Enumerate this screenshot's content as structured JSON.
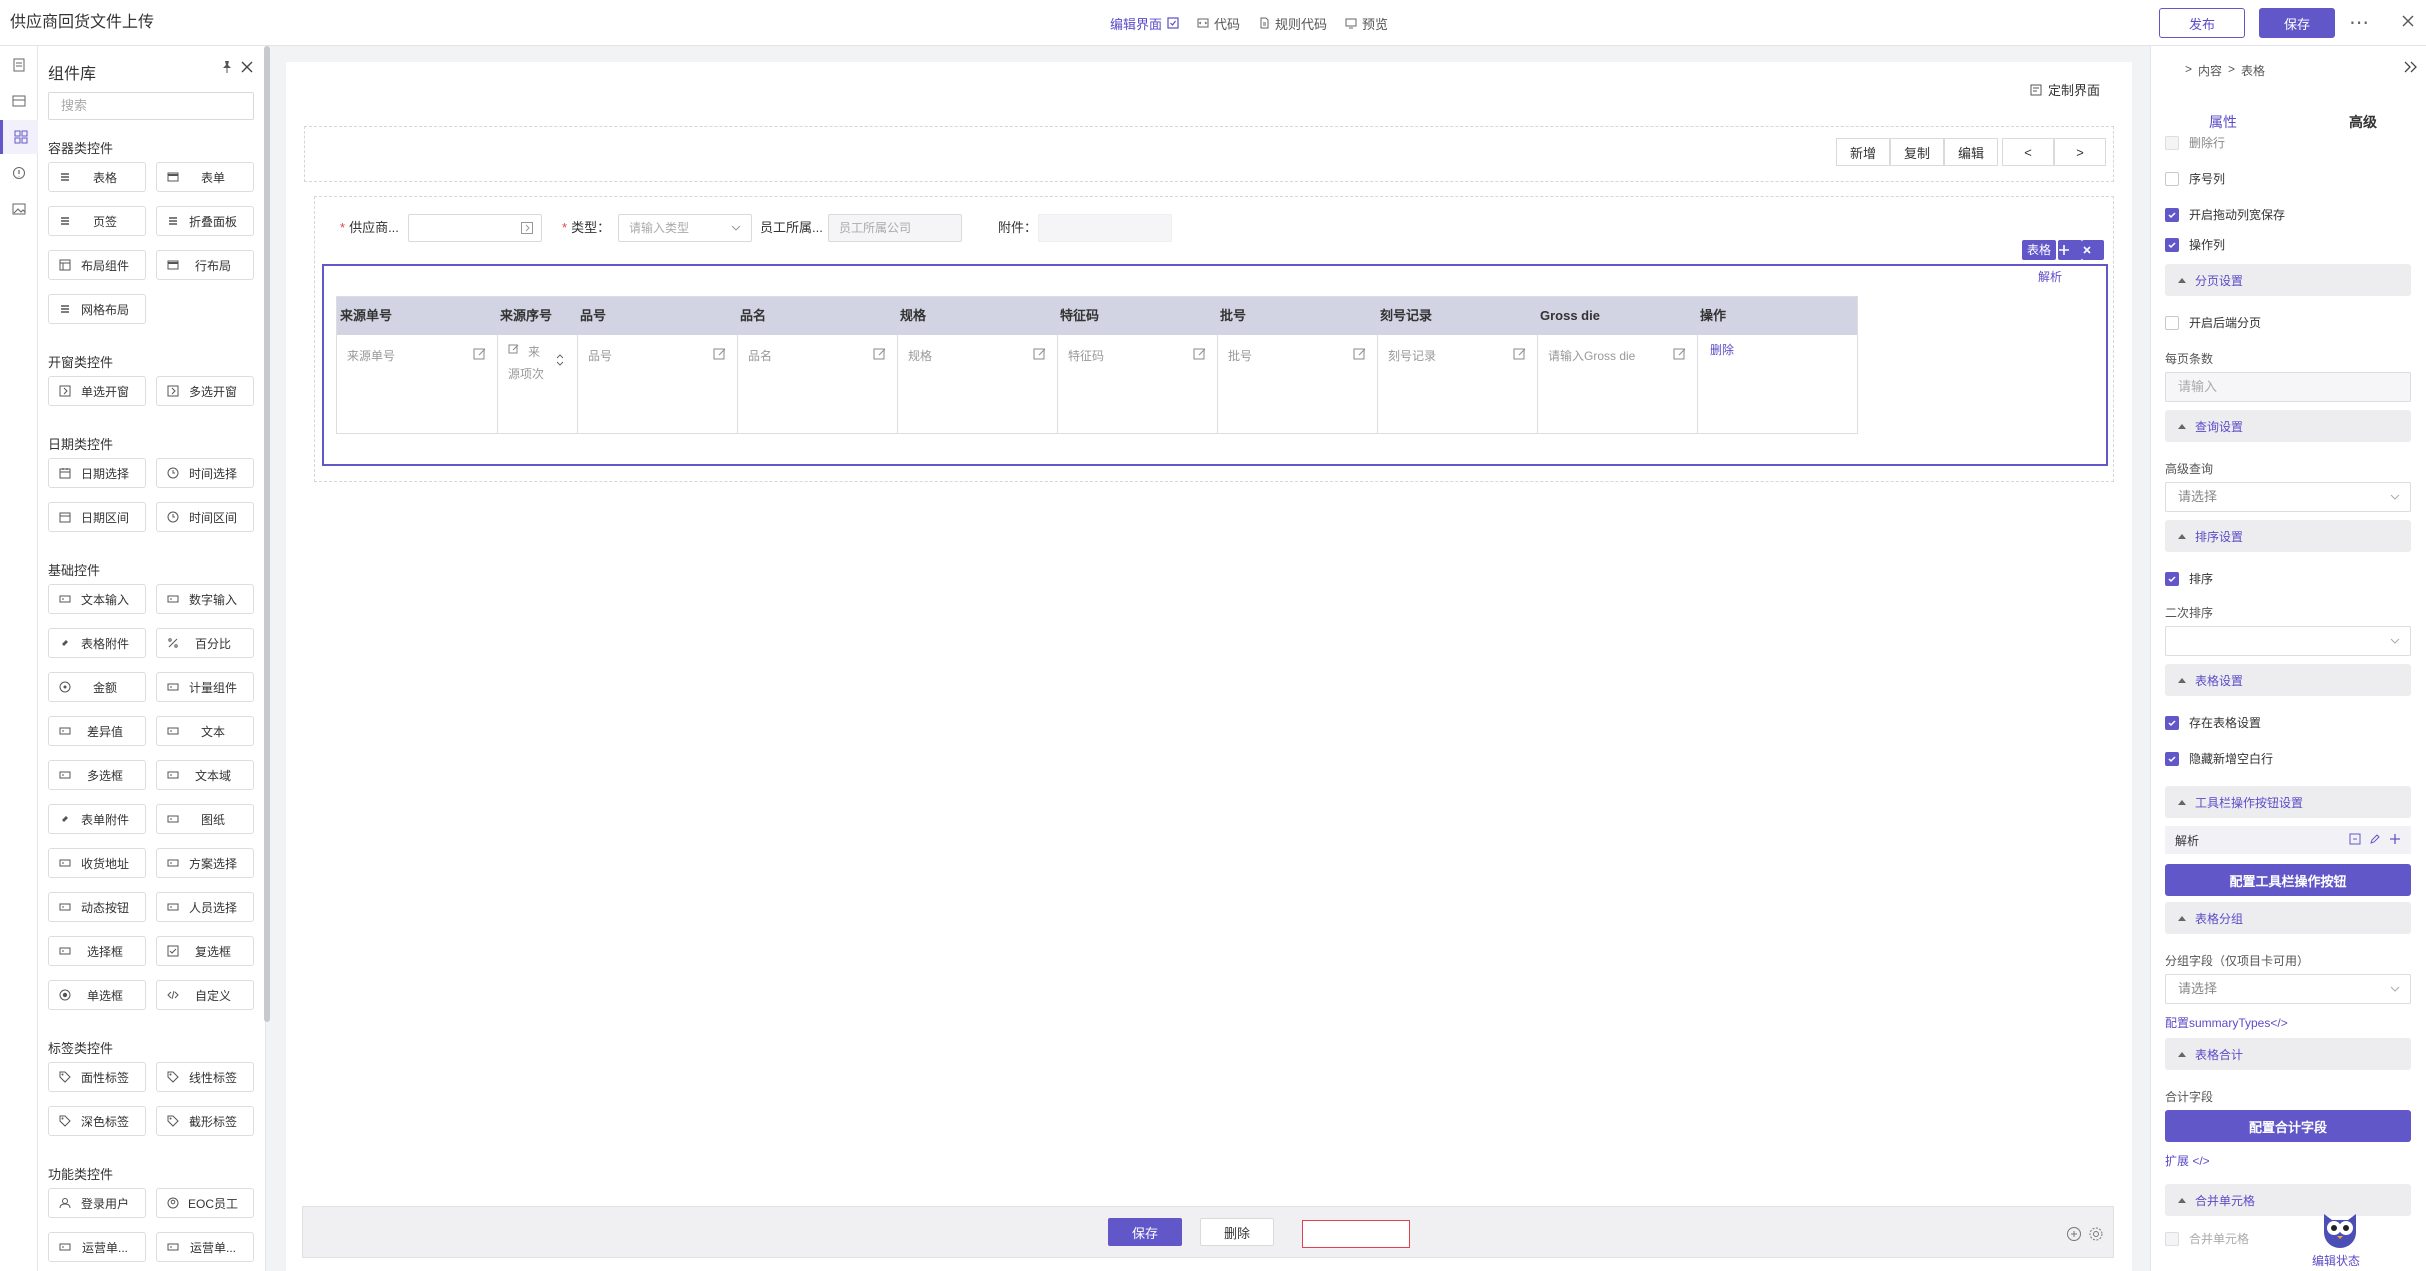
{
  "app": {
    "title": "供应商回货文件上传",
    "center_tabs": [
      {
        "label": "编辑界面",
        "icon": "edit-box-icon",
        "active": true
      },
      {
        "label": "代码",
        "icon": "code-icon",
        "active": false
      },
      {
        "label": "规则代码",
        "icon": "rule-code-icon",
        "active": false
      },
      {
        "label": "预览",
        "icon": "preview-icon",
        "active": false
      }
    ],
    "publish_label": "发布",
    "save_label": "保存",
    "more_label": "⋯"
  },
  "colors": {
    "accent": "#6257c9",
    "header_row": "#d3d4e3",
    "required": "#e0434f"
  },
  "library": {
    "title": "组件库",
    "search_placeholder": "搜索",
    "sections": [
      {
        "title": "容器类控件",
        "items": [
          {
            "label": "表格",
            "icon": "table-stack-icon"
          },
          {
            "label": "表单",
            "icon": "form-icon"
          },
          {
            "label": "页签",
            "icon": "tabs-icon"
          },
          {
            "label": "折叠面板",
            "icon": "collapse-icon"
          },
          {
            "label": "布局组件",
            "icon": "layout-icon"
          },
          {
            "label": "行布局",
            "icon": "row-layout-icon"
          },
          {
            "label": "网格布局",
            "icon": "grid-layout-icon"
          }
        ]
      },
      {
        "title": "开窗类控件",
        "items": [
          {
            "label": "单选开窗",
            "icon": "single-window-icon"
          },
          {
            "label": "多选开窗",
            "icon": "multi-window-icon"
          }
        ]
      },
      {
        "title": "日期类控件",
        "items": [
          {
            "label": "日期选择",
            "icon": "calendar-icon"
          },
          {
            "label": "时间选择",
            "icon": "clock-icon"
          },
          {
            "label": "日期区间",
            "icon": "calendar-range-icon"
          },
          {
            "label": "时间区间",
            "icon": "clock-range-icon"
          }
        ]
      },
      {
        "title": "基础控件",
        "items": [
          {
            "label": "文本输入",
            "icon": "text-input-icon"
          },
          {
            "label": "数字输入",
            "icon": "number-input-icon"
          },
          {
            "label": "表格附件",
            "icon": "attachment-icon"
          },
          {
            "label": "百分比",
            "icon": "percent-icon"
          },
          {
            "label": "金额",
            "icon": "amount-icon"
          },
          {
            "label": "计量组件",
            "icon": "measure-icon"
          },
          {
            "label": "差异值",
            "icon": "diff-icon"
          },
          {
            "label": "文本",
            "icon": "text-icon"
          },
          {
            "label": "多选框",
            "icon": "multi-select-icon"
          },
          {
            "label": "文本域",
            "icon": "textarea-icon"
          },
          {
            "label": "表单附件",
            "icon": "form-attachment-icon"
          },
          {
            "label": "图纸",
            "icon": "drawing-icon"
          },
          {
            "label": "收货地址",
            "icon": "address-icon"
          },
          {
            "label": "方案选择",
            "icon": "scheme-icon"
          },
          {
            "label": "动态按钮",
            "icon": "dynamic-button-icon"
          },
          {
            "label": "人员选择",
            "icon": "person-select-icon"
          },
          {
            "label": "选择框",
            "icon": "select-box-icon"
          },
          {
            "label": "复选框",
            "icon": "checkbox-icon"
          },
          {
            "label": "单选框",
            "icon": "radio-icon"
          },
          {
            "label": "自定义",
            "icon": "custom-code-icon"
          }
        ]
      },
      {
        "title": "标签类控件",
        "items": [
          {
            "label": "面性标签",
            "icon": "tag-icon"
          },
          {
            "label": "线性标签",
            "icon": "tag-icon"
          },
          {
            "label": "深色标签",
            "icon": "tag-icon"
          },
          {
            "label": "截形标签",
            "icon": "tag-icon"
          }
        ]
      },
      {
        "title": "功能类控件",
        "items": [
          {
            "label": "登录用户",
            "icon": "user-icon"
          },
          {
            "label": "EOC员工",
            "icon": "employee-icon"
          },
          {
            "label": "运营单...",
            "icon": "ops-unit-icon"
          },
          {
            "label": "运营单...",
            "icon": "ops-unit-icon"
          }
        ]
      }
    ]
  },
  "canvas": {
    "custom_ui_label": "定制界面",
    "toolbar": [
      "新增",
      "复制",
      "编辑",
      "<",
      ">"
    ],
    "form": {
      "supplier_label": "供应商...",
      "type_label": "类型：",
      "type_placeholder": "请输入类型",
      "employee_label": "员工所属...",
      "employee_value": "员工所属公司",
      "attachment_label": "附件："
    },
    "table_tag": "表格",
    "parse_label": "解析",
    "columns": [
      {
        "header": "来源单号",
        "placeholder": "来源单号"
      },
      {
        "header": "来源序号",
        "placeholder": "来源项次"
      },
      {
        "header": "品号",
        "placeholder": "品号"
      },
      {
        "header": "品名",
        "placeholder": "品名"
      },
      {
        "header": "规格",
        "placeholder": "规格"
      },
      {
        "header": "特征码",
        "placeholder": "特征码"
      },
      {
        "header": "批号",
        "placeholder": "批号"
      },
      {
        "header": "刻号记录",
        "placeholder": "刻号记录"
      },
      {
        "header": "Gross die",
        "placeholder": "请输入Gross die"
      },
      {
        "header": "操作",
        "placeholder": ""
      }
    ],
    "seq_placeholder_line1": "来",
    "seq_placeholder_line2": "源项次",
    "delete_link": "删除",
    "footer_save": "保存",
    "footer_delete": "删除"
  },
  "panel": {
    "breadcrumb": [
      "内容",
      "表格"
    ],
    "tabs": {
      "properties": "属性",
      "advanced": "高级"
    },
    "delete_row": "删除行",
    "serial_col": "序号列",
    "drag_col_save": "开启拖动列宽保存",
    "action_col": "操作列",
    "paging_group": "分页设置",
    "backend_paging": "开启后端分页",
    "page_size_label": "每页条数",
    "page_size_placeholder": "请输入",
    "query_group": "查询设置",
    "adv_query_label": "高级查询",
    "adv_query_placeholder": "请选择",
    "sort_group": "排序设置",
    "sort_label": "排序",
    "second_sort_label": "二次排序",
    "table_settings_group": "表格设置",
    "save_table_settings": "存在表格设置",
    "hide_empty_row": "隐藏新增空白行",
    "toolbar_group": "工具栏操作按钮设置",
    "toolbar_item": "解析",
    "config_toolbar_button": "配置工具栏操作按钮",
    "grouping_group": "表格分组",
    "group_field_label": "分组字段（仅项目卡可用）",
    "group_field_placeholder": "请选择",
    "summary_link": "配置summaryTypes</>",
    "total_group": "表格合计",
    "total_field_label": "合计字段",
    "config_total_button": "配置合计字段",
    "extend_link": "扩展 </>",
    "merge_group": "合并单元格",
    "merge_cells": "合并单元格",
    "edit_status": "编辑状态"
  }
}
